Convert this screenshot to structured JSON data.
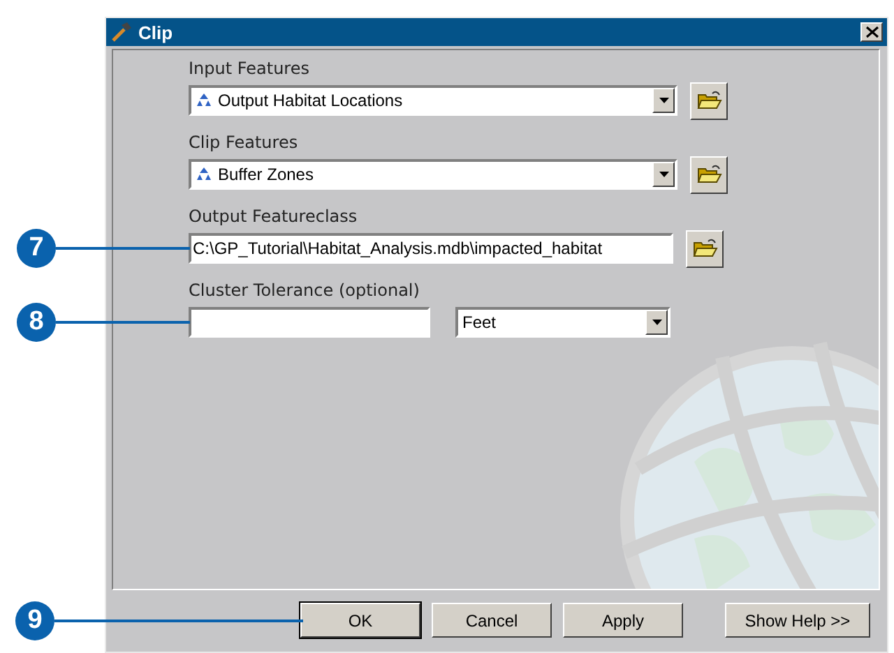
{
  "window": {
    "title": "Clip"
  },
  "fields": [
    {
      "kind": "combo",
      "label": "Input Features",
      "value": "Output Habitat Locations"
    },
    {
      "kind": "combo",
      "label": "Clip Features",
      "value": "Buffer Zones"
    },
    {
      "kind": "path",
      "label": "Output Featureclass",
      "value": "C:\\GP_Tutorial\\Habitat_Analysis.mdb\\impacted_habitat",
      "callout": "7"
    },
    {
      "kind": "tolerance",
      "label": "Cluster Tolerance (optional)",
      "unit": "Feet",
      "callout": "8"
    }
  ],
  "buttons": [
    {
      "label": "OK",
      "default": true,
      "callout": "9"
    },
    {
      "label": "Cancel",
      "default": false
    },
    {
      "label": "Apply",
      "default": false
    },
    {
      "label": "Show Help >>",
      "default": false
    }
  ]
}
